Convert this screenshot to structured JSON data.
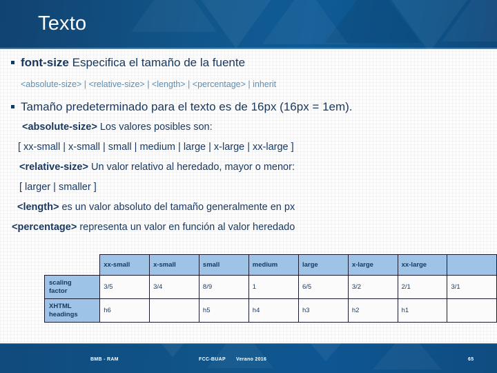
{
  "header": {
    "title": "Texto",
    "bg_color": "#0f5b96"
  },
  "content": {
    "lines": [
      {
        "id": "l1",
        "bullet": true,
        "bold": "font-size",
        "rest": " Especifica el tamaño de la fuente"
      },
      {
        "id": "l2",
        "bullet": false,
        "text": "<absolute-size> | <relative-size> | <length> | <percentage> | inherit"
      },
      {
        "id": "l3",
        "bullet": true,
        "bold": "",
        "rest": "Tamaño predeterminado para el texto es de 16px (16px = 1em)."
      },
      {
        "id": "l4",
        "bullet": false,
        "bold": "<absolute-size>",
        "rest": " Los valores posibles son:"
      },
      {
        "id": "l5",
        "bullet": false,
        "bold": "",
        "rest": "[ xx-small | x-small | small | medium | large | x-large | xx-large ]"
      },
      {
        "id": "l6",
        "bullet": false,
        "bold": "<relative-size>",
        "rest": " Un valor relativo al heredado, mayor o menor:"
      },
      {
        "id": "l7",
        "bullet": false,
        "bold": "",
        "rest": "[ larger | smaller ]"
      },
      {
        "id": "l8",
        "bullet": false,
        "bold": "<length>",
        "rest": " es un valor absoluto del tamaño generalmente en px"
      },
      {
        "id": "l9",
        "bullet": false,
        "bold": "<percentage>",
        "rest": " representa un valor en función al valor heredado"
      }
    ],
    "line1_bold": "font-size",
    "line1_rest": " Especifica el tamaño de la fuente",
    "line2": "<absolute-size> | <relative-size> | <length> | <percentage> | inherit",
    "line3": "Tamaño predeterminado para el texto es de 16px (16px = 1em).",
    "line4_bold": "<absolute-size>",
    "line4_rest": " Los valores posibles son:",
    "line5": "[ xx-small | x-small | small | medium | large | x-large | xx-large ]",
    "line6_bold": "<relative-size>",
    "line6_rest": " Un valor relativo al heredado, mayor o menor:",
    "line7": "[ larger | smaller ]",
    "line8_bold": "<length>",
    "line8_rest": " es un valor absoluto del tamaño generalmente en px",
    "line9_bold": "<percentage>",
    "line9_rest": " representa un valor en función al valor heredado"
  },
  "table": {
    "corner": "",
    "headers": [
      "xx-small",
      "x-small",
      "small",
      "medium",
      "large",
      "x-large",
      "xx-large",
      ""
    ],
    "rows": [
      {
        "label_line1": "scaling",
        "label_line2": "factor",
        "cells": [
          "3/5",
          "3/4",
          "8/9",
          "1",
          "6/5",
          "3/2",
          "2/1",
          "3/1"
        ]
      },
      {
        "label_line1": "XHTML",
        "label_line2": "headings",
        "cells": [
          "h6",
          "",
          "h5",
          "h4",
          "h3",
          "h2",
          "h1",
          ""
        ]
      }
    ],
    "header_bg": "#9dc3e6"
  },
  "footer": {
    "left": "BMB - RAM",
    "mid1": "FCC-BUAP",
    "mid2": "Verano 2016",
    "page": "65"
  }
}
